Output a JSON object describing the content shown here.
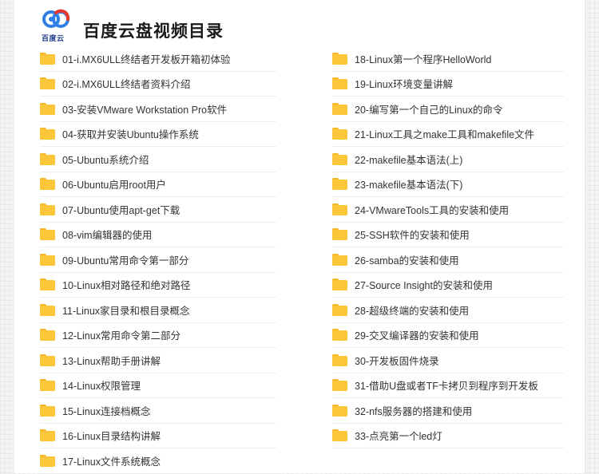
{
  "header": {
    "logo_text": "百度云",
    "title": "百度云盘视频目录"
  },
  "colors": {
    "folder": "#fcc63b",
    "folder_tab": "#f5b727",
    "logo_blue": "#2f7fe8",
    "logo_red": "#e8372e"
  },
  "icons": {
    "logo": "baidu-cloud-logo-icon",
    "folder": "folder-icon"
  },
  "left_items": [
    "01-i.MX6ULL终结者开发板开箱初体验",
    "02-i.MX6ULL终结者资料介绍",
    "03-安装VMware Workstation Pro软件",
    "04-获取并安装Ubuntu操作系统",
    "05-Ubuntu系统介绍",
    "06-Ubuntu启用root用户",
    "07-Ubuntu使用apt-get下载",
    "08-vim编辑器的使用",
    "09-Ubuntu常用命令第一部分",
    "10-Linux相对路径和绝对路径",
    "11-Linux家目录和根目录概念",
    "12-Linux常用命令第二部分",
    "13-Linux帮助手册讲解",
    "14-Linux权限管理",
    "15-Linux连接档概念",
    "16-Linux目录结构讲解",
    "17-Linux文件系统概念"
  ],
  "right_items": [
    "18-Linux第一个程序HelloWorld",
    "19-Linux环境变量讲解",
    "20-编写第一个自己的Linux的命令",
    "21-Linux工具之make工具和makefile文件",
    "22-makefile基本语法(上)",
    "23-makefile基本语法(下)",
    "24-VMwareTools工具的安装和使用",
    "25-SSH软件的安装和使用",
    "26-samba的安装和使用",
    "27-Source Insight的安装和使用",
    "28-超级终端的安装和使用",
    "29-交叉编译器的安装和使用",
    "30-开发板固件烧录",
    "31-借助U盘或者TF卡拷贝到程序到开发板",
    "32-nfs服务器的搭建和使用",
    "33-点亮第一个led灯"
  ]
}
